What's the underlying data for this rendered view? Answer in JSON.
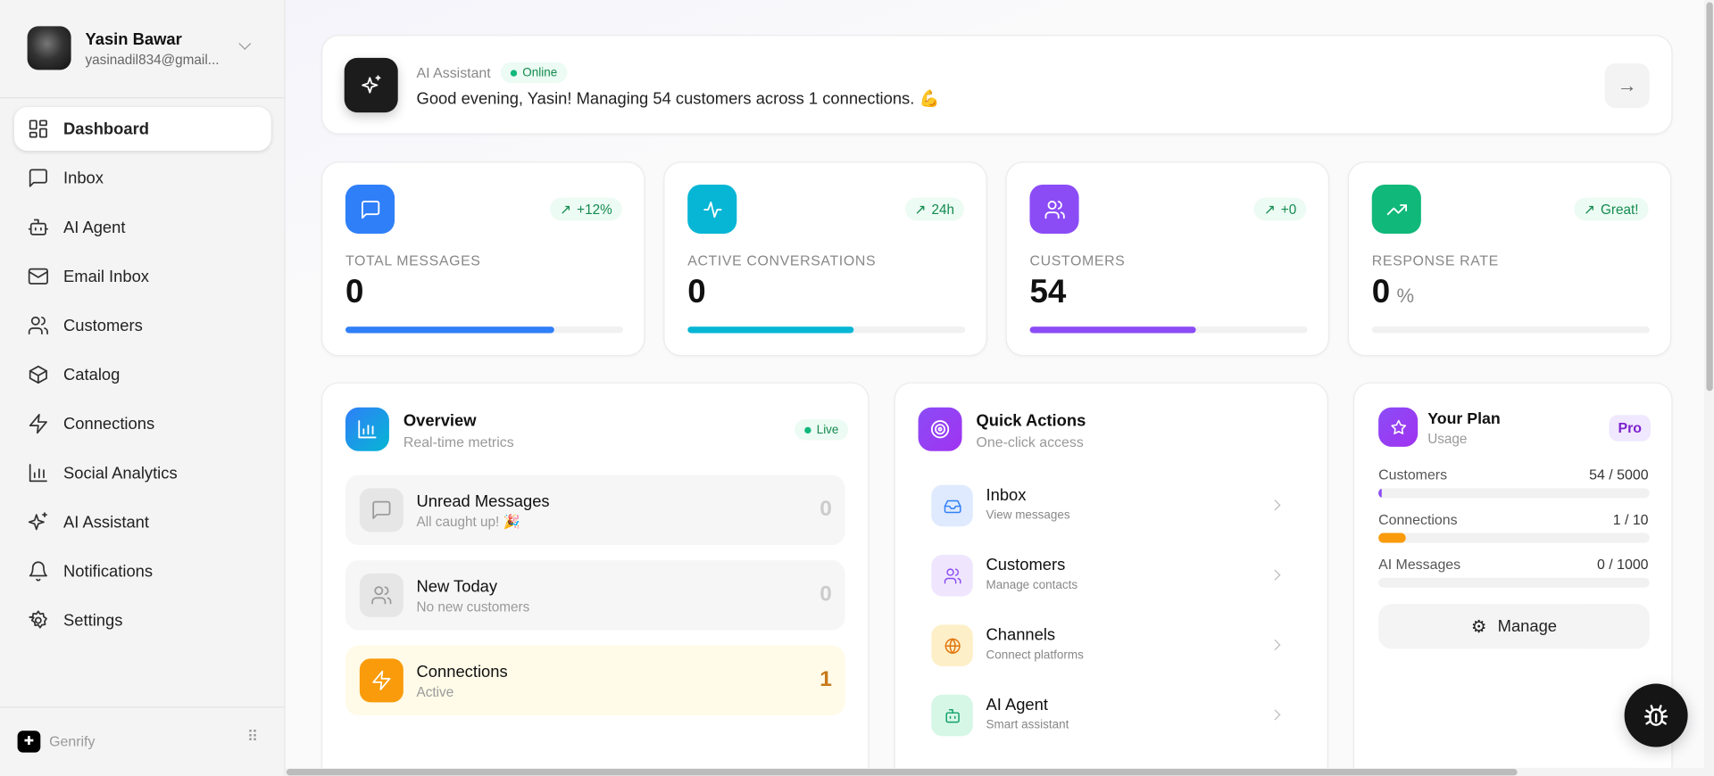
{
  "user": {
    "name": "Yasin Bawar",
    "email": "yasinadil834@gmail..."
  },
  "nav": [
    {
      "label": "Dashboard",
      "icon": "layout-grid-icon"
    },
    {
      "label": "Inbox",
      "icon": "message-square-icon"
    },
    {
      "label": "AI Agent",
      "icon": "bot-icon"
    },
    {
      "label": "Email Inbox",
      "icon": "mail-icon"
    },
    {
      "label": "Customers",
      "icon": "users-icon"
    },
    {
      "label": "Catalog",
      "icon": "package-icon"
    },
    {
      "label": "Connections",
      "icon": "zap-icon"
    },
    {
      "label": "Social Analytics",
      "icon": "bar-chart-icon"
    },
    {
      "label": "AI Assistant",
      "icon": "sparkles-icon"
    },
    {
      "label": "Notifications",
      "icon": "bell-icon"
    },
    {
      "label": "Settings",
      "icon": "gear-icon"
    }
  ],
  "brand": "Genrify",
  "assistant": {
    "title": "AI Assistant",
    "status": "Online",
    "message": "Good evening, Yasin! Managing 54 customers across 1 connections. 💪"
  },
  "stats": [
    {
      "label": "TOTAL MESSAGES",
      "value": "0",
      "badge": "+12%",
      "color": "#2f7ff8",
      "progress": 75
    },
    {
      "label": "ACTIVE CONVERSATIONS",
      "value": "0",
      "badge": "24h",
      "color": "#06b6d4",
      "progress": 60
    },
    {
      "label": "CUSTOMERS",
      "value": "54",
      "badge": "+0",
      "color": "#8b4cf6",
      "progress": 60
    },
    {
      "label": "RESPONSE RATE",
      "value": "0",
      "unit": "%",
      "badge": "Great!",
      "color": "#10b87a",
      "progress": 0
    }
  ],
  "overview": {
    "title": "Overview",
    "subtitle": "Real-time metrics",
    "live": "Live",
    "rows": [
      {
        "title": "Unread Messages",
        "sub": "All caught up! 🎉",
        "count": "0"
      },
      {
        "title": "New Today",
        "sub": "No new customers",
        "count": "0"
      },
      {
        "title": "Connections",
        "sub": "Active",
        "count": "1"
      }
    ]
  },
  "quick": {
    "title": "Quick Actions",
    "subtitle": "One-click access",
    "items": [
      {
        "title": "Inbox",
        "sub": "View messages"
      },
      {
        "title": "Customers",
        "sub": "Manage contacts"
      },
      {
        "title": "Channels",
        "sub": "Connect platforms"
      },
      {
        "title": "AI Agent",
        "sub": "Smart assistant"
      }
    ]
  },
  "plan": {
    "title": "Your Plan",
    "subtitle": "Usage",
    "tier": "Pro",
    "usage": [
      {
        "label": "Customers",
        "value": "54 / 5000",
        "pct": 1.08
      },
      {
        "label": "Connections",
        "value": "1 / 10",
        "pct": 10
      },
      {
        "label": "AI Messages",
        "value": "0 / 1000",
        "pct": 0
      }
    ],
    "manage": "Manage"
  }
}
